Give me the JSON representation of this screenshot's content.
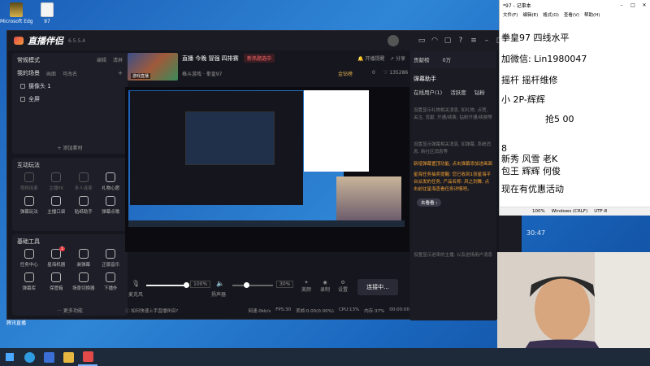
{
  "desktop": {
    "icons": [
      {
        "label": "Microsoft Edge"
      },
      {
        "label": "97"
      }
    ],
    "recycle": {
      "label": "腾讯直播"
    }
  },
  "app": {
    "name": "直播伴侣",
    "version": "6.5.5.4",
    "left": {
      "mode": "常规模式",
      "edit": "编辑",
      "clear": "清屏",
      "scene": "我的场景",
      "scene_tabs": [
        "画面",
        "可改名"
      ],
      "sources": [
        "摄像头 1",
        "全屏"
      ],
      "add_source": "+ 添加素材",
      "interact_title": "互动玩法",
      "interact_tools": [
        "视频连麦",
        "主播PK",
        "多人连麦",
        "礼物心愿",
        "弹幕玩法",
        "主播口袋",
        "贴纸助手",
        "弹幕点歌"
      ],
      "basic_title": "基础工具",
      "basic_tools": [
        "任务中心",
        "星海机器",
        "装弹幕",
        "正版音乐",
        "弹幕库",
        "保管箱",
        "场景切换器",
        "下播外"
      ],
      "basic_badge": "1",
      "more": "更多功能"
    },
    "stream": {
      "title": "直播 今晚 冒强 四排赛",
      "category": "格斗游戏 · 拳皇97",
      "cover_label": "游戏直播",
      "button": "新热题选中",
      "announce": "开播提醒",
      "share": "分享",
      "level": "金钻榜",
      "fans": "0",
      "likes": "135286"
    },
    "controls": {
      "mic_label": "麦克风",
      "mic_volume": "100%",
      "speaker_label": "扬声器",
      "speaker_volume": "30%",
      "beauty": "美颜",
      "record": "录制",
      "settings": "设置",
      "connect": "连接中..."
    },
    "statusbar": {
      "help": "如何快速上手直播伴侣?",
      "net": "网速:0kb/s",
      "fps": "FPS:30",
      "drop": "丢帧:0.00(0.00%)",
      "cpu": "CPU:13%",
      "mem": "内存:37%",
      "time": "00:00:00"
    },
    "right": {
      "ranking": "贡献榜",
      "count": "0万",
      "hot": "热度",
      "detail": "详情",
      "danmu_title": "弹幕助手",
      "tabs": [
        "在线用户(1)",
        "活跃度",
        "钻粉"
      ],
      "gift_tip": "设置显示礼物相关消息, 如礼物, 点赞, 关注, 贡献, 开通/续费, 钻粉开通/续费等",
      "gift_value": "0.0",
      "chat_tip": "设置显示弹幕相关消息, 如弹幕, 系统消息, 新社区消息等",
      "online_count": "0观/0人",
      "notice1": "新增弹幕置顶功能, 点击弹幕添加进画面",
      "notice2": "星海任务抽奖提醒: 您已收到1张星海平台派发的任务, 产品名称: 风之剑舞, 点击前往星海查看任务详情吧。",
      "go_button": "去看看 ›",
      "entry_tip": "设置显示进来的主播, 以及进场用户消息"
    }
  },
  "inner_window_title": "*97 - 记事本",
  "notepad": {
    "title": "*97 - 记事本",
    "menu": [
      "文件(F)",
      "编辑(E)",
      "格式(O)",
      "查看(V)",
      "帮助(H)"
    ],
    "lines": [
      "拳皇97 四线水平",
      "加微信:  Lin1980047",
      "摇杆 摇杆维修",
      "小             2P-辉辉",
      "抢5    00",
      "8",
      "新秀 风雪 老K",
      "包王 辉辉 何俊",
      "现在有优惠活动"
    ],
    "status": [
      "100%",
      "Windows (CRLF)",
      "UTF-8"
    ],
    "clock": "30:47"
  },
  "taskbar": {
    "apps": [
      "start",
      "edge",
      "bilibili",
      "explorer",
      "zhibo"
    ]
  },
  "colors": {
    "accent": "#e6393f",
    "panel": "#1e1e28",
    "orange": "#f0a030"
  }
}
